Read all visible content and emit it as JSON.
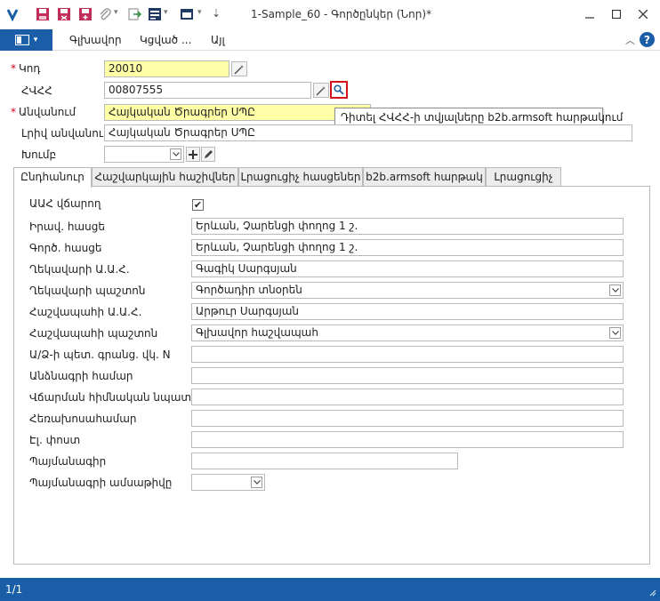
{
  "window": {
    "title": "1-Sample_60 - Գործընկեր (Նոր)*"
  },
  "menu": {
    "items": [
      "Գլխավոր",
      "Կցված ...",
      "Այլ"
    ]
  },
  "form": {
    "code": {
      "label": "Կոդ",
      "value": "20010",
      "required": true
    },
    "tin": {
      "label": "ՀՎՀՀ",
      "value": "00807555"
    },
    "name": {
      "label": "Անվանում",
      "value": "Հայկական Ծրագրեր ՍՊԸ",
      "required": true
    },
    "full_name": {
      "label": "Լրիվ անվանում",
      "value": "Հայկական Ծրագրեր ՍՊԸ"
    },
    "group": {
      "label": "Խումբ",
      "value": ""
    }
  },
  "tooltip": {
    "text": "Դիտել ՀՎՀՀ-ի տվյալները  b2b.armsoft հարթակում"
  },
  "tabs": [
    "Ընդհանուր",
    "Հաշվարկային հաշիվներ",
    "Լրացուցիչ հասցեներ",
    "b2b.armsoft հարթակ",
    "Լրացուցիչ"
  ],
  "general": {
    "vat_payer": {
      "label": "ԱԱՀ վճարող",
      "checked": true,
      "mark": "✔"
    },
    "legal_address": {
      "label": "Իրավ. հասցե",
      "value": "Երևան, Չարենցի փողոց 1 շ."
    },
    "work_address": {
      "label": "Գործ. հասցե",
      "value": "Երևան, Չարենցի փողոց 1 շ."
    },
    "director_name": {
      "label": "Ղեկավարի Ա.Ա.Հ.",
      "value": "Գագիկ Սարգսյան"
    },
    "director_position": {
      "label": "Ղեկավարի պաշտոն",
      "value": "Գործադիր տնօրեն"
    },
    "accountant_name": {
      "label": "Հաշվապահի Ա.Ա.Հ.",
      "value": "Արթուր Սարգսյան"
    },
    "accountant_position": {
      "label": "Հաշվապահի պաշտոն",
      "value": "Գլխավոր հաշվապահ"
    },
    "state_reg": {
      "label": "Ա/Ձ-ի պետ. գրանց. վկ. N",
      "value": ""
    },
    "passport": {
      "label": "Անձնագրի համար",
      "value": ""
    },
    "payment_purpose": {
      "label": "Վճարման հիմնական նպատակ",
      "value": ""
    },
    "phone": {
      "label": "Հեռախոսահամար",
      "value": ""
    },
    "email": {
      "label": "Էլ. փոստ",
      "value": ""
    },
    "contract": {
      "label": "Պայմանագիր",
      "value": ""
    },
    "contract_date": {
      "label": "Պայմանագրի ամսաթիվը",
      "value": "  /  /"
    }
  },
  "status": {
    "page": "1/1"
  },
  "colors": {
    "accent": "#1a5ea8",
    "required_field": "#ffffa8",
    "highlight_border": "#d4121e"
  }
}
